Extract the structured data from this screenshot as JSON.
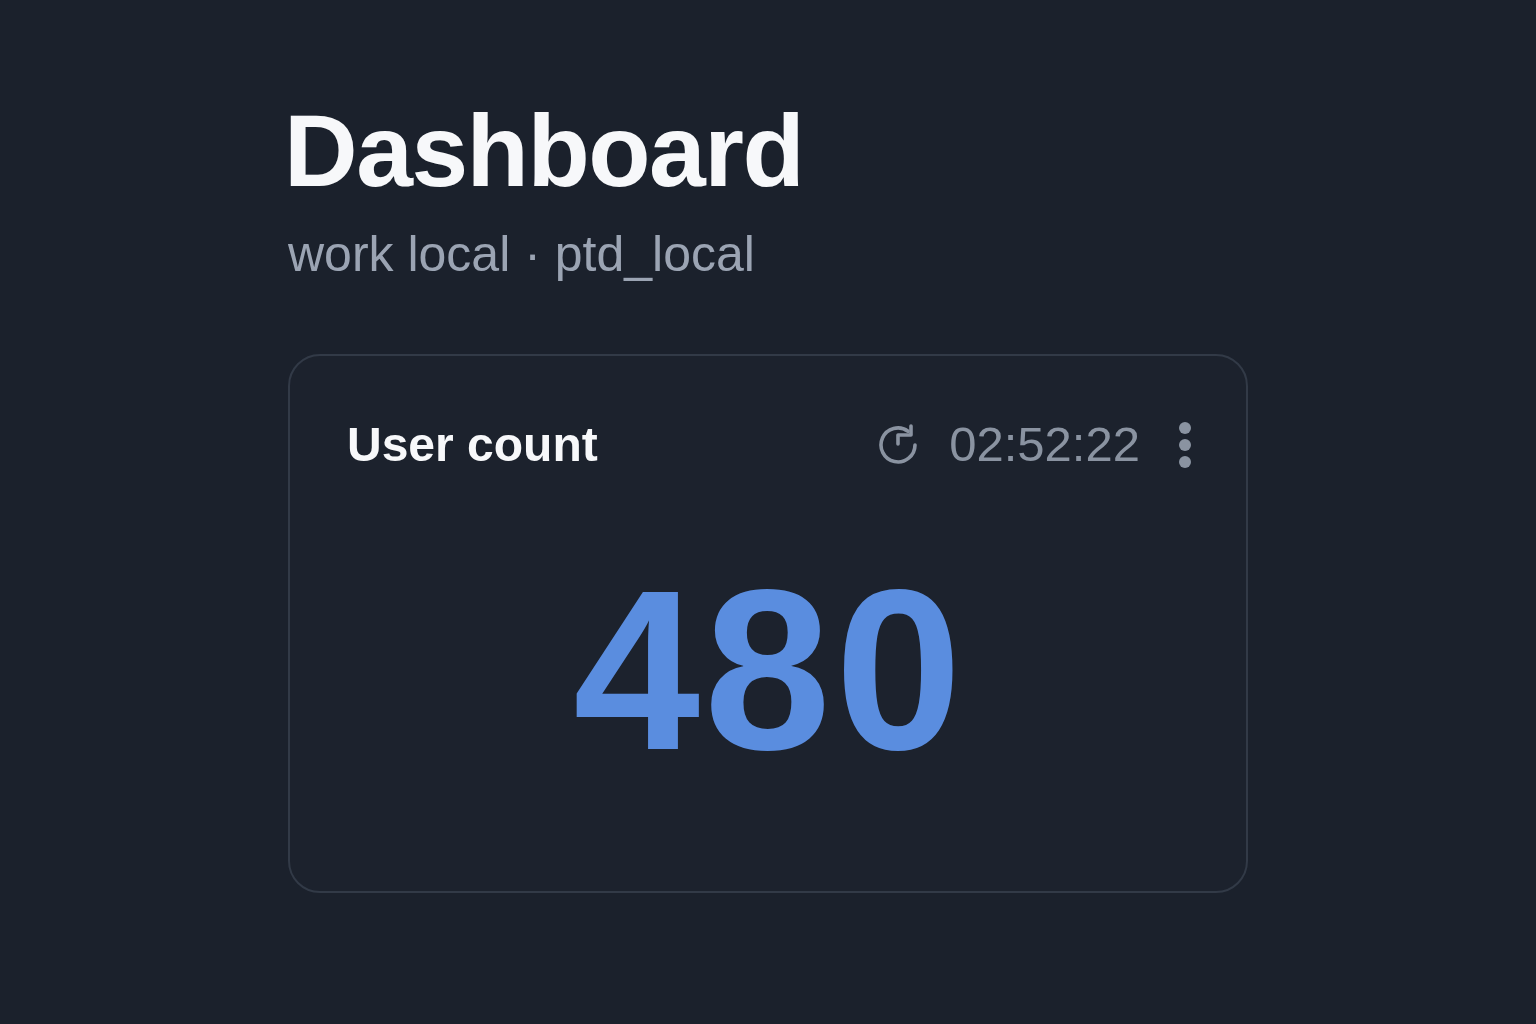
{
  "page": {
    "title": "Dashboard",
    "subtitle": "work local · ptd_local"
  },
  "widgets": [
    {
      "kind": "stat",
      "title": "User count",
      "refreshed_at": "02:52:22",
      "value": "480"
    }
  ]
}
